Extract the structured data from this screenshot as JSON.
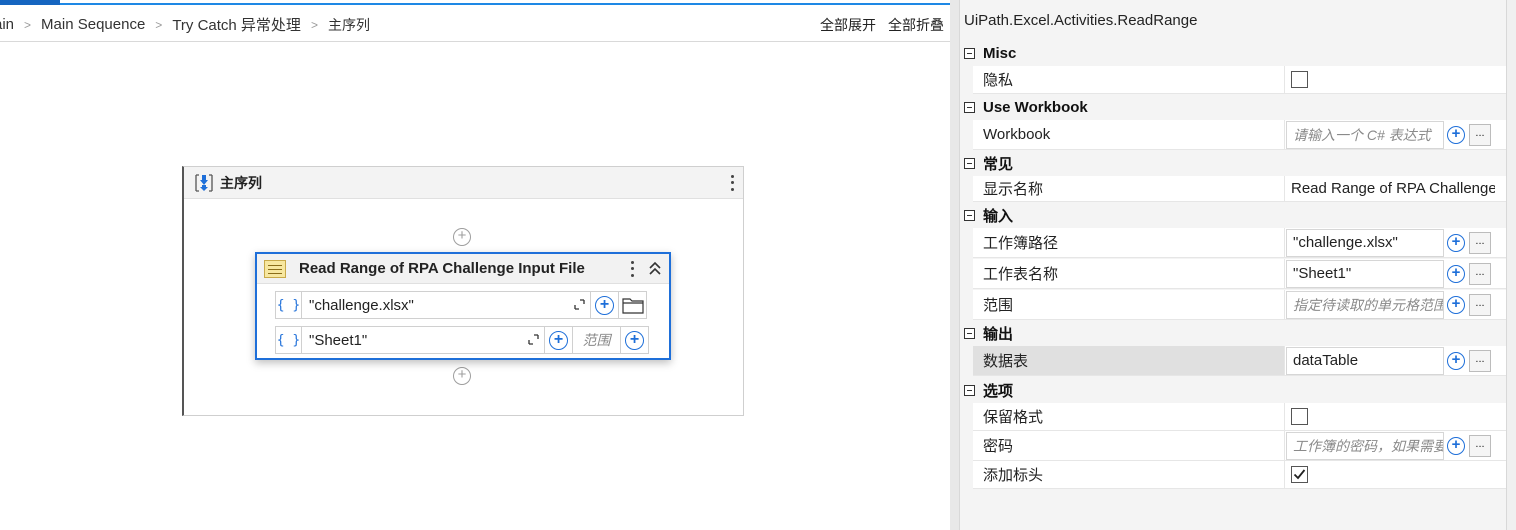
{
  "breadcrumb": {
    "items": [
      "ain",
      "Main Sequence",
      "Try Catch 异常处理",
      "主序列"
    ]
  },
  "toolbar": {
    "expand_all": "全部展开",
    "collapse_all": "全部折叠"
  },
  "sequence": {
    "title": "主序列"
  },
  "activity": {
    "title": "Read Range of RPA Challenge Input File",
    "workbook_value": "\"challenge.xlsx\"",
    "sheet_value": "\"Sheet1\"",
    "range_placeholder": "范围",
    "brace_label": "{ }"
  },
  "properties": {
    "type_name": "UiPath.Excel.Activities.ReadRange",
    "more_label": "...",
    "categories": {
      "misc": "Misc",
      "use_workbook": "Use Workbook",
      "common": "常见",
      "input": "输入",
      "output": "输出",
      "options": "选项"
    },
    "rows": {
      "privacy": {
        "name": "隐私",
        "checked": false
      },
      "workbook": {
        "name": "Workbook",
        "placeholder": "请输入一个 C# 表达式"
      },
      "display_name": {
        "name": "显示名称",
        "value": "Read Range of RPA Challenge Input File"
      },
      "workbook_path": {
        "name": "工作簿路径",
        "value": "\"challenge.xlsx\""
      },
      "sheet_name": {
        "name": "工作表名称",
        "value": "\"Sheet1\""
      },
      "range": {
        "name": "范围",
        "placeholder": "指定待读取的单元格范围"
      },
      "data_table": {
        "name": "数据表",
        "value": "dataTable"
      },
      "preserve_format": {
        "name": "保留格式",
        "checked": false
      },
      "password": {
        "name": "密码",
        "placeholder": "工作簿的密码，如果需要"
      },
      "add_headers": {
        "name": "添加标头",
        "checked": true
      }
    }
  },
  "colors": {
    "accent": "#1e6fd9",
    "tab_active": "#1565c0",
    "panel_bg": "#f4f4f4",
    "selected_row": "#e0e0e0"
  },
  "icons": [
    "sequence-icon",
    "excel-read-range-icon",
    "kebab-menu-icon",
    "collapse-icon",
    "expand-editor-icon",
    "add-icon",
    "folder-icon",
    "collapse-category-icon",
    "checkbox-icon"
  ]
}
